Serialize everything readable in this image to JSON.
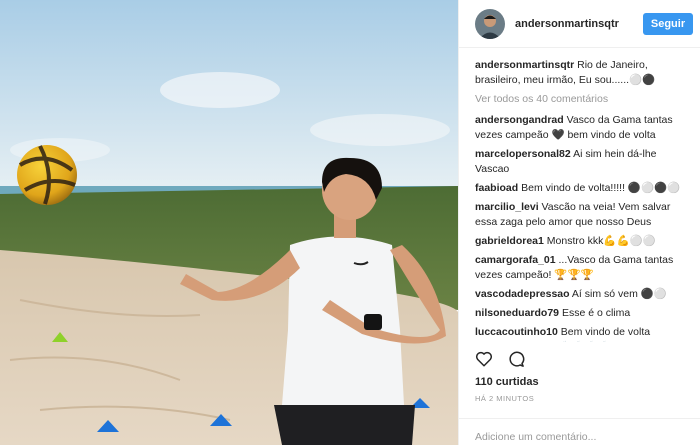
{
  "post": {
    "username": "andersonmartinsqtr",
    "follow_label": "Seguir",
    "caption": {
      "user": "andersonmartinsqtr",
      "text": "Rio de Janeiro, brasileiro, meu irmão, Eu sou......⚪⚫"
    },
    "view_all": "Ver todos os 40 comentários",
    "comments": [
      {
        "user": "andersongandrad",
        "text": "Vasco da Gama tantas vezes campeão 🖤 bem vindo de volta"
      },
      {
        "user": "marcelopersonal82",
        "text": "Ai sim hein dá-lhe Vascao"
      },
      {
        "user": "faabioad",
        "text": "Bem vindo de volta!!!!! ⚫⚪⚫⚪"
      },
      {
        "user": "marcilio_levi",
        "text": "Vascão na veia! Vem salvar essa zaga pelo amor que nosso Deus"
      },
      {
        "user": "gabrieldorea1",
        "text": "Monstro kkk💪💪⚪⚪"
      },
      {
        "user": "camargorafa_01",
        "text": "...Vasco da Gama tantas vezes campeão! 🏆🏆🏆"
      },
      {
        "user": "vascodadepressao",
        "text": "Aí sim só vem ⚫⚪"
      },
      {
        "user": "nilsoneduardo79",
        "text": "Esse é o clima"
      },
      {
        "user": "luccacoutinho10",
        "text": "Bem vindo de volta monstro! Vascão 👏👏👏👏"
      }
    ],
    "likes": "110 curtidas",
    "time": "HÁ 2 MINUTOS",
    "comment_placeholder": "Adicione um comentário...",
    "icons": {
      "like": "heart-icon",
      "comment": "comment-bubble-icon"
    },
    "colors": {
      "follow": "#3897f0",
      "text": "#262626",
      "muted": "#999999"
    }
  }
}
